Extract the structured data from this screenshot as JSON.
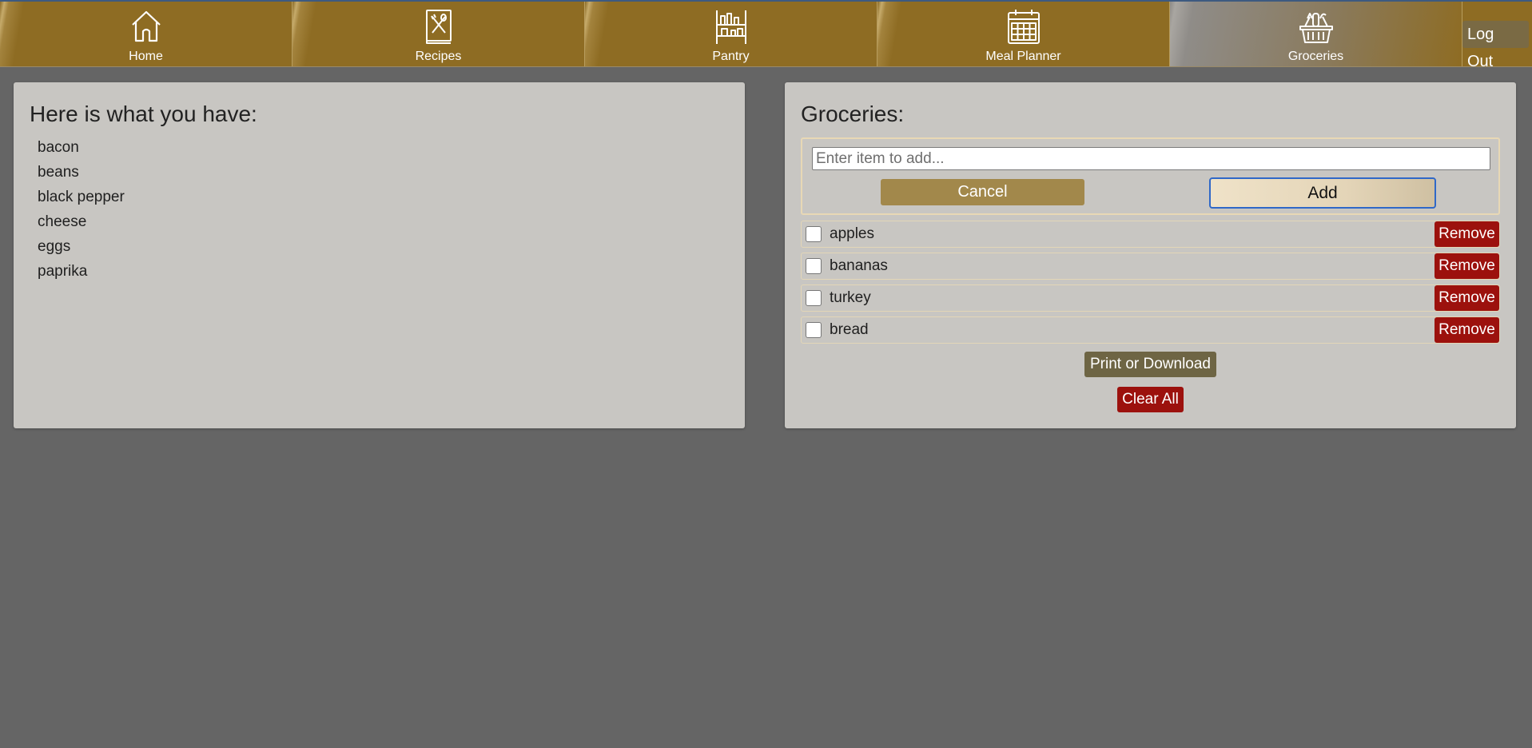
{
  "nav": {
    "items": [
      {
        "label": "Home",
        "icon": "house-icon",
        "active": false
      },
      {
        "label": "Recipes",
        "icon": "recipe-book-icon",
        "active": false
      },
      {
        "label": "Pantry",
        "icon": "pantry-shelf-icon",
        "active": false
      },
      {
        "label": "Meal Planner",
        "icon": "calendar-icon",
        "active": false
      },
      {
        "label": "Groceries",
        "icon": "grocery-basket-icon",
        "active": true
      }
    ],
    "logout_label": "Log Out"
  },
  "pantry": {
    "title": "Here is what you have:",
    "items": [
      "bacon",
      "beans",
      "black pepper",
      "cheese",
      "eggs",
      "paprika"
    ]
  },
  "groceries": {
    "title": "Groceries:",
    "input_placeholder": "Enter item to add...",
    "cancel_label": "Cancel",
    "add_label": "Add",
    "remove_label": "Remove",
    "items": [
      {
        "name": "apples",
        "checked": false
      },
      {
        "name": "bananas",
        "checked": false
      },
      {
        "name": "turkey",
        "checked": false
      },
      {
        "name": "bread",
        "checked": false
      }
    ],
    "print_label": "Print or Download",
    "clear_label": "Clear All"
  },
  "colors": {
    "nav_gold": "#8e6c23",
    "panel_bg": "#c8c6c2",
    "page_bg": "#656565",
    "remove_red": "#9c110d",
    "cancel_gold": "#a2884b",
    "print_olive": "#6e6544"
  }
}
